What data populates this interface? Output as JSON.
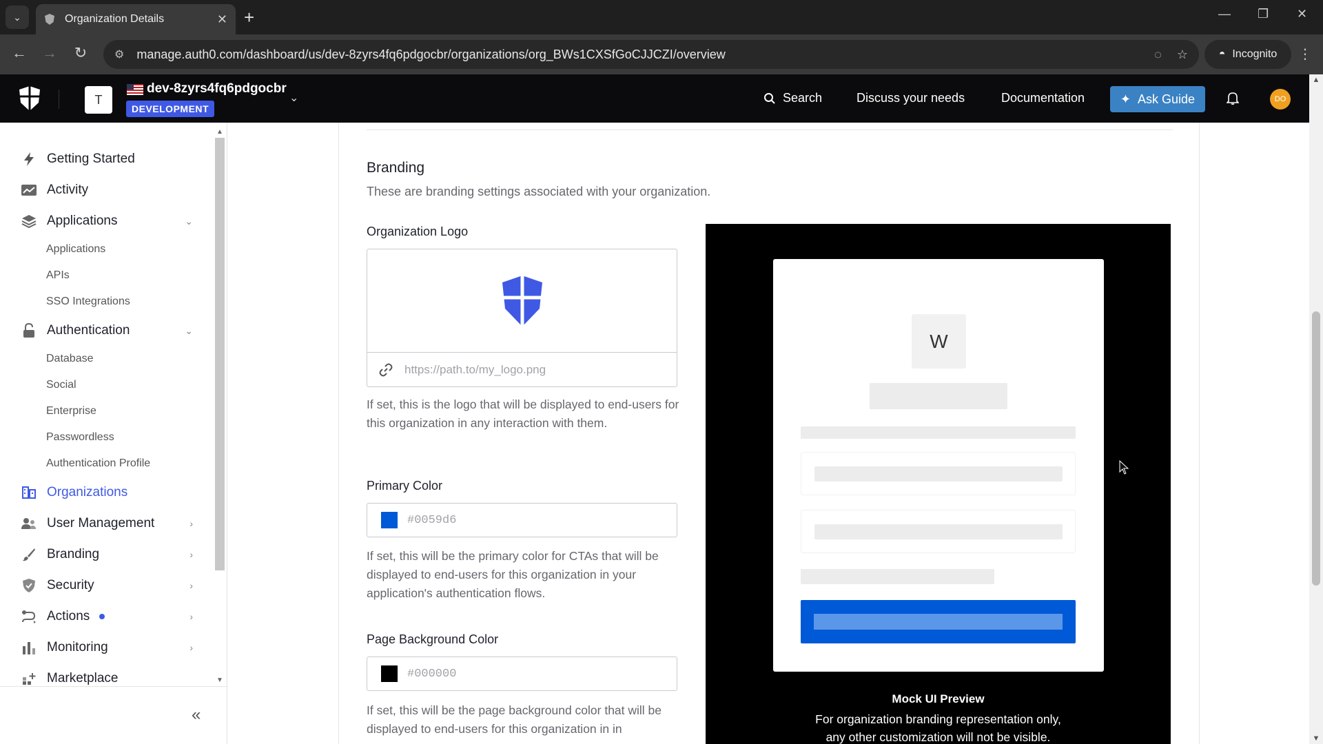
{
  "browser": {
    "tab_title": "Organization Details",
    "url": "manage.auth0.com/dashboard/us/dev-8zyrs4fq6pdgocbr/organizations/org_BWs1CXSfGoCJJCZI/overview",
    "incognito_label": "Incognito"
  },
  "header": {
    "tenant_initial": "T",
    "tenant_name": "dev-8zyrs4fq6pdgocbr",
    "env_badge": "DEVELOPMENT",
    "search_label": "Search",
    "discuss_label": "Discuss your needs",
    "docs_label": "Documentation",
    "ask_guide_label": "Ask Guide",
    "user_initials": "DO"
  },
  "sidebar": {
    "items": [
      {
        "label": "Getting Started"
      },
      {
        "label": "Activity"
      },
      {
        "label": "Applications"
      },
      {
        "label": "Authentication"
      },
      {
        "label": "Organizations"
      },
      {
        "label": "User Management"
      },
      {
        "label": "Branding"
      },
      {
        "label": "Security"
      },
      {
        "label": "Actions"
      },
      {
        "label": "Monitoring"
      },
      {
        "label": "Marketplace"
      }
    ],
    "applications_sub": [
      "Applications",
      "APIs",
      "SSO Integrations"
    ],
    "authentication_sub": [
      "Database",
      "Social",
      "Enterprise",
      "Passwordless",
      "Authentication Profile"
    ],
    "collapse_label": "«"
  },
  "branding": {
    "title": "Branding",
    "description": "These are branding settings associated with your organization.",
    "logo_label": "Organization Logo",
    "logo_placeholder": "https://path.to/my_logo.png",
    "logo_help": "If set, this is the logo that will be displayed to end-users for this organization in any interaction with them.",
    "primary_label": "Primary Color",
    "primary_placeholder": "#0059d6",
    "primary_swatch": "#0059d6",
    "primary_help": "If set, this will be the primary color for CTAs that will be displayed to end-users for this organization in your application's authentication flows.",
    "bg_label": "Page Background Color",
    "bg_placeholder": "#000000",
    "bg_swatch": "#000000",
    "bg_help": "If set, this will be the page background color that will be displayed to end-users for this organization in in"
  },
  "mock_preview": {
    "avatar_letter": "W",
    "title": "Mock UI Preview",
    "subtitle_line1": "For organization branding representation only,",
    "subtitle_line2": "any other customization will not be visible."
  }
}
